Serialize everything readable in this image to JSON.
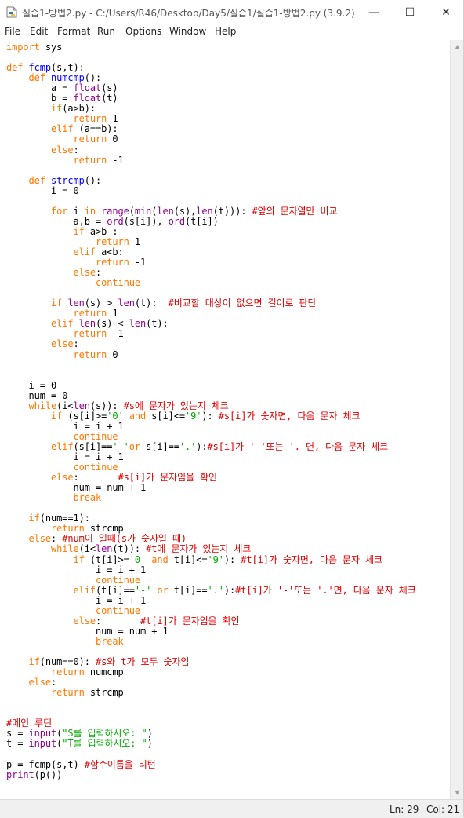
{
  "window": {
    "title": "실습1-방법2.py - C:/Users/R46/Desktop/Day5/실습1/실습1-방법2.py (3.9.2)",
    "minimize_glyph": "—",
    "maximize_glyph": "☐",
    "close_glyph": "✕"
  },
  "menu": [
    "File",
    "Edit",
    "Format",
    "Run",
    "Options",
    "Window",
    "Help"
  ],
  "colors": {
    "keyword": "#ff7700",
    "builtin": "#900090",
    "definition": "#0000ff",
    "comment": "#dd0000",
    "string": "#00aa00"
  },
  "code": [
    {
      "line": 1,
      "segs": [
        [
          "k",
          "import"
        ],
        [
          "n",
          " sys"
        ]
      ]
    },
    {
      "line": 3,
      "segs": [
        [
          "k",
          "def"
        ],
        [
          "n",
          " "
        ],
        [
          "d",
          "fcmp"
        ],
        [
          "n",
          "(s,t):"
        ]
      ]
    },
    {
      "line": 4,
      "segs": [
        [
          "n",
          "    "
        ],
        [
          "k",
          "def"
        ],
        [
          "n",
          " "
        ],
        [
          "d",
          "numcmp"
        ],
        [
          "n",
          "():"
        ]
      ]
    },
    {
      "line": 5,
      "segs": [
        [
          "n",
          "        a = "
        ],
        [
          "b",
          "float"
        ],
        [
          "n",
          "(s)"
        ]
      ]
    },
    {
      "line": 6,
      "segs": [
        [
          "n",
          "        b = "
        ],
        [
          "b",
          "float"
        ],
        [
          "n",
          "(t)"
        ]
      ]
    },
    {
      "line": 7,
      "segs": [
        [
          "n",
          "        "
        ],
        [
          "k",
          "if"
        ],
        [
          "n",
          "(a>b):"
        ]
      ]
    },
    {
      "line": 8,
      "segs": [
        [
          "n",
          "            "
        ],
        [
          "k",
          "return"
        ],
        [
          "n",
          " 1"
        ]
      ]
    },
    {
      "line": 9,
      "segs": [
        [
          "n",
          "        "
        ],
        [
          "k",
          "elif"
        ],
        [
          "n",
          " (a==b):"
        ]
      ]
    },
    {
      "line": 10,
      "segs": [
        [
          "n",
          "            "
        ],
        [
          "k",
          "return"
        ],
        [
          "n",
          " 0"
        ]
      ]
    },
    {
      "line": 11,
      "segs": [
        [
          "n",
          "        "
        ],
        [
          "k",
          "else"
        ],
        [
          "n",
          ":"
        ]
      ]
    },
    {
      "line": 12,
      "segs": [
        [
          "n",
          "            "
        ],
        [
          "k",
          "return"
        ],
        [
          "n",
          " -1"
        ]
      ]
    },
    {
      "line": 14,
      "segs": [
        [
          "n",
          "    "
        ],
        [
          "k",
          "def"
        ],
        [
          "n",
          " "
        ],
        [
          "d",
          "strcmp"
        ],
        [
          "n",
          "():"
        ]
      ]
    },
    {
      "line": 15,
      "segs": [
        [
          "n",
          "        i = 0"
        ]
      ]
    },
    {
      "line": 17,
      "segs": [
        [
          "n",
          "        "
        ],
        [
          "k",
          "for"
        ],
        [
          "n",
          " i "
        ],
        [
          "k",
          "in"
        ],
        [
          "n",
          " "
        ],
        [
          "b",
          "range"
        ],
        [
          "n",
          "("
        ],
        [
          "b",
          "min"
        ],
        [
          "n",
          "("
        ],
        [
          "b",
          "len"
        ],
        [
          "n",
          "(s),"
        ],
        [
          "b",
          "len"
        ],
        [
          "n",
          "(t))): "
        ],
        [
          "c",
          "#앞의 문자열만 비교"
        ]
      ]
    },
    {
      "line": 18,
      "segs": [
        [
          "n",
          "            a,b = "
        ],
        [
          "b",
          "ord"
        ],
        [
          "n",
          "(s[i]), "
        ],
        [
          "b",
          "ord"
        ],
        [
          "n",
          "(t[i])"
        ]
      ]
    },
    {
      "line": 19,
      "segs": [
        [
          "n",
          "            "
        ],
        [
          "k",
          "if"
        ],
        [
          "n",
          " a>b :"
        ]
      ]
    },
    {
      "line": 20,
      "segs": [
        [
          "n",
          "                "
        ],
        [
          "k",
          "return"
        ],
        [
          "n",
          " 1"
        ]
      ]
    },
    {
      "line": 21,
      "segs": [
        [
          "n",
          "            "
        ],
        [
          "k",
          "elif"
        ],
        [
          "n",
          " a<b:"
        ]
      ]
    },
    {
      "line": 22,
      "segs": [
        [
          "n",
          "                "
        ],
        [
          "k",
          "return"
        ],
        [
          "n",
          " -1"
        ]
      ]
    },
    {
      "line": 23,
      "segs": [
        [
          "n",
          "            "
        ],
        [
          "k",
          "else"
        ],
        [
          "n",
          ":"
        ]
      ]
    },
    {
      "line": 24,
      "segs": [
        [
          "n",
          "                "
        ],
        [
          "k",
          "continue"
        ]
      ]
    },
    {
      "line": 26,
      "segs": [
        [
          "n",
          "        "
        ],
        [
          "k",
          "if"
        ],
        [
          "n",
          " "
        ],
        [
          "b",
          "len"
        ],
        [
          "n",
          "(s) > "
        ],
        [
          "b",
          "len"
        ],
        [
          "n",
          "(t):  "
        ],
        [
          "c",
          "#비교할 대상이 없으면 길이로 판단"
        ]
      ]
    },
    {
      "line": 27,
      "segs": [
        [
          "n",
          "            "
        ],
        [
          "k",
          "return"
        ],
        [
          "n",
          " 1"
        ]
      ]
    },
    {
      "line": 28,
      "segs": [
        [
          "n",
          "        "
        ],
        [
          "k",
          "elif"
        ],
        [
          "n",
          " "
        ],
        [
          "b",
          "len"
        ],
        [
          "n",
          "(s) < "
        ],
        [
          "b",
          "len"
        ],
        [
          "n",
          "(t):"
        ]
      ]
    },
    {
      "line": 29,
      "segs": [
        [
          "n",
          "            "
        ],
        [
          "k",
          "return"
        ],
        [
          "n",
          " -1"
        ]
      ]
    },
    {
      "line": 30,
      "segs": [
        [
          "n",
          "        "
        ],
        [
          "k",
          "else"
        ],
        [
          "n",
          ":"
        ]
      ]
    },
    {
      "line": 31,
      "segs": [
        [
          "n",
          "            "
        ],
        [
          "k",
          "return"
        ],
        [
          "n",
          " 0"
        ]
      ]
    },
    {
      "line": 34,
      "segs": [
        [
          "n",
          "    i = 0"
        ]
      ]
    },
    {
      "line": 35,
      "segs": [
        [
          "n",
          "    num = 0"
        ]
      ]
    },
    {
      "line": 36,
      "segs": [
        [
          "n",
          "    "
        ],
        [
          "k",
          "while"
        ],
        [
          "n",
          "(i<"
        ],
        [
          "b",
          "len"
        ],
        [
          "n",
          "(s)): "
        ],
        [
          "c",
          "#s에 문자가 있는지 체크"
        ]
      ]
    },
    {
      "line": 37,
      "segs": [
        [
          "n",
          "        "
        ],
        [
          "k",
          "if"
        ],
        [
          "n",
          " (s[i]>="
        ],
        [
          "s",
          "'0'"
        ],
        [
          "n",
          " "
        ],
        [
          "k",
          "and"
        ],
        [
          "n",
          " s[i]<="
        ],
        [
          "s",
          "'9'"
        ],
        [
          "n",
          "): "
        ],
        [
          "c",
          "#s[i]가 숫자면, 다음 문자 체크"
        ]
      ]
    },
    {
      "line": 38,
      "segs": [
        [
          "n",
          "            i = i + 1"
        ]
      ]
    },
    {
      "line": 39,
      "segs": [
        [
          "n",
          "            "
        ],
        [
          "k",
          "continue"
        ]
      ]
    },
    {
      "line": 40,
      "segs": [
        [
          "n",
          "        "
        ],
        [
          "k",
          "elif"
        ],
        [
          "n",
          "(s[i]=="
        ],
        [
          "s",
          "'-'"
        ],
        [
          "k",
          "or"
        ],
        [
          "n",
          " s[i]=="
        ],
        [
          "s",
          "'.'"
        ],
        [
          "n",
          "):"
        ],
        [
          "c",
          "#s[i]가 '-'또는 '.'면, 다음 문자 체크"
        ]
      ]
    },
    {
      "line": 41,
      "segs": [
        [
          "n",
          "            i = i + 1"
        ]
      ]
    },
    {
      "line": 42,
      "segs": [
        [
          "n",
          "            "
        ],
        [
          "k",
          "continue"
        ]
      ]
    },
    {
      "line": 43,
      "segs": [
        [
          "n",
          "        "
        ],
        [
          "k",
          "else"
        ],
        [
          "n",
          ":       "
        ],
        [
          "c",
          "#s[i]가 문자임을 확인"
        ]
      ]
    },
    {
      "line": 44,
      "segs": [
        [
          "n",
          "            num = num + 1"
        ]
      ]
    },
    {
      "line": 45,
      "segs": [
        [
          "n",
          "            "
        ],
        [
          "k",
          "break"
        ]
      ]
    },
    {
      "line": 47,
      "segs": [
        [
          "n",
          "    "
        ],
        [
          "k",
          "if"
        ],
        [
          "n",
          "(num==1):"
        ]
      ]
    },
    {
      "line": 48,
      "segs": [
        [
          "n",
          "        "
        ],
        [
          "k",
          "return"
        ],
        [
          "n",
          " strcmp"
        ]
      ]
    },
    {
      "line": 49,
      "segs": [
        [
          "n",
          "    "
        ],
        [
          "k",
          "else"
        ],
        [
          "n",
          ": "
        ],
        [
          "c",
          "#num이 일때(s가 숫자일 때)"
        ]
      ]
    },
    {
      "line": 50,
      "segs": [
        [
          "n",
          "        "
        ],
        [
          "k",
          "while"
        ],
        [
          "n",
          "(i<"
        ],
        [
          "b",
          "len"
        ],
        [
          "n",
          "(t)): "
        ],
        [
          "c",
          "#t에 문자가 있는지 체크"
        ]
      ]
    },
    {
      "line": 51,
      "segs": [
        [
          "n",
          "            "
        ],
        [
          "k",
          "if"
        ],
        [
          "n",
          " (t[i]>="
        ],
        [
          "s",
          "'0'"
        ],
        [
          "n",
          " "
        ],
        [
          "k",
          "and"
        ],
        [
          "n",
          " t[i]<="
        ],
        [
          "s",
          "'9'"
        ],
        [
          "n",
          "): "
        ],
        [
          "c",
          "#t[i]가 숫자면, 다음 문자 체크"
        ]
      ]
    },
    {
      "line": 52,
      "segs": [
        [
          "n",
          "                i = i + 1"
        ]
      ]
    },
    {
      "line": 53,
      "segs": [
        [
          "n",
          "                "
        ],
        [
          "k",
          "continue"
        ]
      ]
    },
    {
      "line": 54,
      "segs": [
        [
          "n",
          "            "
        ],
        [
          "k",
          "elif"
        ],
        [
          "n",
          "(t[i]=="
        ],
        [
          "s",
          "'-'"
        ],
        [
          "n",
          " "
        ],
        [
          "k",
          "or"
        ],
        [
          "n",
          " t[i]=="
        ],
        [
          "s",
          "'.'"
        ],
        [
          "n",
          "):"
        ],
        [
          "c",
          "#t[i]가 '-'또는 '.'면, 다음 문자 체크"
        ]
      ]
    },
    {
      "line": 55,
      "segs": [
        [
          "n",
          "                i = i + 1"
        ]
      ]
    },
    {
      "line": 56,
      "segs": [
        [
          "n",
          "                "
        ],
        [
          "k",
          "continue"
        ]
      ]
    },
    {
      "line": 57,
      "segs": [
        [
          "n",
          "            "
        ],
        [
          "k",
          "else"
        ],
        [
          "n",
          ":       "
        ],
        [
          "c",
          "#t[i]가 문자임을 확인"
        ]
      ]
    },
    {
      "line": 58,
      "segs": [
        [
          "n",
          "                num = num + 1"
        ]
      ]
    },
    {
      "line": 59,
      "segs": [
        [
          "n",
          "                "
        ],
        [
          "k",
          "break"
        ]
      ]
    },
    {
      "line": 61,
      "segs": [
        [
          "n",
          "    "
        ],
        [
          "k",
          "if"
        ],
        [
          "n",
          "(num==0): "
        ],
        [
          "c",
          "#s와 t가 모두 숫자임"
        ]
      ]
    },
    {
      "line": 62,
      "segs": [
        [
          "n",
          "        "
        ],
        [
          "k",
          "return"
        ],
        [
          "n",
          " numcmp"
        ]
      ]
    },
    {
      "line": 63,
      "segs": [
        [
          "n",
          "    "
        ],
        [
          "k",
          "else"
        ],
        [
          "n",
          ":"
        ]
      ]
    },
    {
      "line": 64,
      "segs": [
        [
          "n",
          "        "
        ],
        [
          "k",
          "return"
        ],
        [
          "n",
          " strcmp"
        ]
      ]
    },
    {
      "line": 67,
      "segs": [
        [
          "c",
          "#메인 루틴"
        ]
      ]
    },
    {
      "line": 68,
      "segs": [
        [
          "n",
          "s = "
        ],
        [
          "b",
          "input"
        ],
        [
          "n",
          "("
        ],
        [
          "s",
          "\"S를 입력하시오: \""
        ],
        [
          "n",
          ")"
        ]
      ]
    },
    {
      "line": 69,
      "segs": [
        [
          "n",
          "t = "
        ],
        [
          "b",
          "input"
        ],
        [
          "n",
          "("
        ],
        [
          "s",
          "\"T를 입력하시오: \""
        ],
        [
          "n",
          ")"
        ]
      ]
    },
    {
      "line": 71,
      "segs": [
        [
          "n",
          "p = fcmp(s,t) "
        ],
        [
          "c",
          "#함수이름을 리턴"
        ]
      ]
    },
    {
      "line": 72,
      "segs": [
        [
          "b",
          "print"
        ],
        [
          "n",
          "(p())"
        ]
      ]
    }
  ],
  "status": {
    "line": "Ln: 29",
    "col": "Col: 21"
  }
}
